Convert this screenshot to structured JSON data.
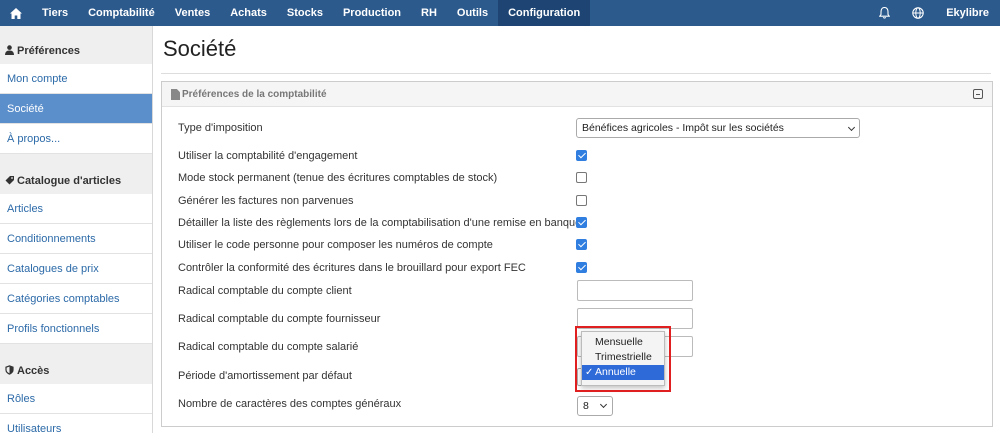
{
  "topnav": {
    "home_icon": "home-icon",
    "items": [
      "Tiers",
      "Comptabilité",
      "Ventes",
      "Achats",
      "Stocks",
      "Production",
      "RH",
      "Outils",
      "Configuration"
    ],
    "active": "Configuration",
    "right": {
      "bell_icon": "bell-icon",
      "globe_icon": "globe-icon",
      "user": "Ekylibre"
    }
  },
  "sidebar": {
    "sections": [
      {
        "title": "Préférences",
        "icon": "user-icon",
        "items": [
          "Mon compte",
          "Société",
          "À propos..."
        ]
      },
      {
        "title": "Catalogue d'articles",
        "icon": "tags-icon",
        "items": [
          "Articles",
          "Conditionnements",
          "Catalogues de prix",
          "Catégories comptables",
          "Profils fonctionnels"
        ]
      },
      {
        "title": "Accès",
        "icon": "shield-icon",
        "items": [
          "Rôles",
          "Utilisateurs"
        ]
      }
    ],
    "active": "Société"
  },
  "page": {
    "title": "Société"
  },
  "panel": {
    "title": "Préférences de la comptabilité",
    "tax_label": "Type d'imposition",
    "tax_value": "Bénéfices agricoles - Impôt sur les sociétés",
    "checkboxes": [
      {
        "label": "Utiliser la comptabilité d'engagement",
        "checked": true
      },
      {
        "label": "Mode stock permanent (tenue des écritures comptables de stock)",
        "checked": false
      },
      {
        "label": "Générer les factures non parvenues",
        "checked": false
      },
      {
        "label": "Détailler la liste des règlements lors de la comptabilisation d'une remise en banque",
        "checked": true
      },
      {
        "label": "Utiliser le code personne pour composer les numéros de compte",
        "checked": true
      },
      {
        "label": "Contrôler la conformité des écritures dans le brouillard pour export FEC",
        "checked": true
      }
    ],
    "client_label": "Radical comptable du compte client",
    "supplier_label": "Radical comptable du compte fournisseur",
    "employee_label": "Radical comptable du compte salarié",
    "period_label": "Période d'amortissement par défaut",
    "period_options": [
      "Mensuelle",
      "Trimestrielle",
      "Annuelle"
    ],
    "period_selected": "Annuelle",
    "chars_label": "Nombre de caractères des comptes généraux",
    "chars_value": "8"
  },
  "colors": {
    "nav_bg": "#2c5a8c",
    "nav_active": "#1d4472",
    "sidebar_active": "#5b8fcc",
    "link": "#2c6aa8",
    "checkbox": "#2f7ee0",
    "highlight": "#e02020"
  }
}
